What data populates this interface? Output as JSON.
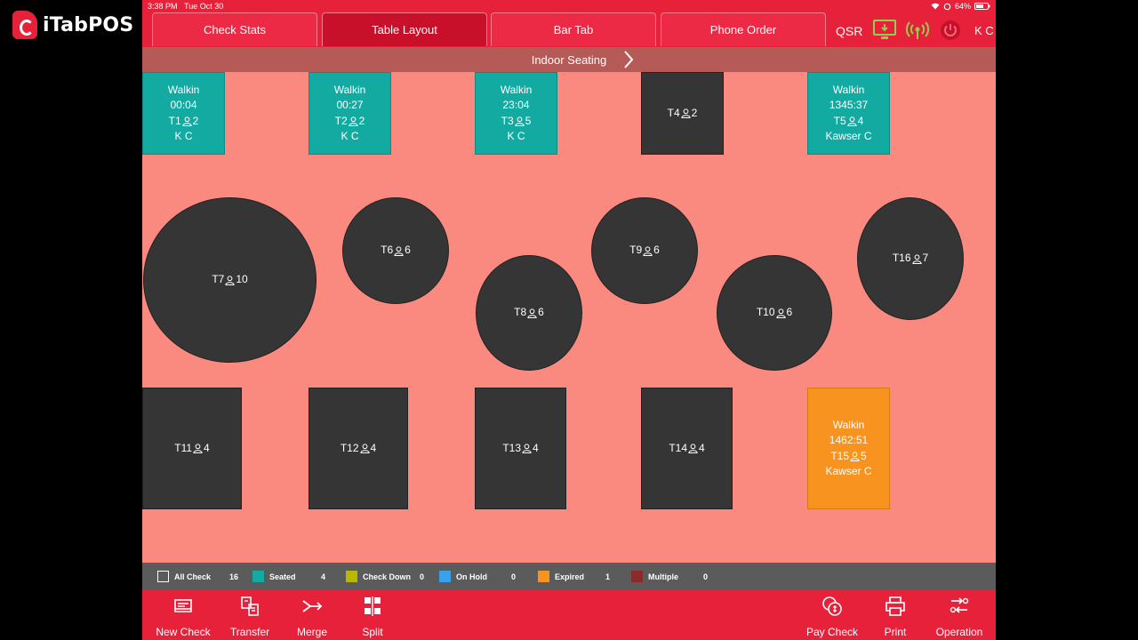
{
  "brand": {
    "name": "iTabPOS"
  },
  "status": {
    "time": "3:38 PM",
    "date": "Tue Oct 30",
    "battery": "64%"
  },
  "nav": {
    "tabs": [
      {
        "label": "Check Stats",
        "active": false
      },
      {
        "label": "Table Layout",
        "active": true
      },
      {
        "label": "Bar Tab",
        "active": false
      },
      {
        "label": "Phone Order",
        "active": false
      }
    ],
    "qsr_label": "QSR",
    "user_initials": "K C"
  },
  "section": {
    "title": "Indoor Seating"
  },
  "tables": [
    {
      "id": "T1",
      "seats": "2",
      "status": "seated",
      "customer": "Walkin",
      "time": "00:04",
      "server": "K C"
    },
    {
      "id": "T2",
      "seats": "2",
      "status": "seated",
      "customer": "Walkin",
      "time": "00:27",
      "server": "K C"
    },
    {
      "id": "T3",
      "seats": "5",
      "status": "seated",
      "customer": "Walkin",
      "time": "23:04",
      "server": "K C"
    },
    {
      "id": "T4",
      "seats": "2",
      "status": "open"
    },
    {
      "id": "T5",
      "seats": "4",
      "status": "seated",
      "customer": "Walkin",
      "time": "1345:37",
      "server": "Kawser C"
    },
    {
      "id": "T6",
      "seats": "6",
      "status": "open"
    },
    {
      "id": "T7",
      "seats": "10",
      "status": "open"
    },
    {
      "id": "T8",
      "seats": "6",
      "status": "open"
    },
    {
      "id": "T9",
      "seats": "6",
      "status": "open"
    },
    {
      "id": "T10",
      "seats": "6",
      "status": "open"
    },
    {
      "id": "T16",
      "seats": "7",
      "status": "open"
    },
    {
      "id": "T11",
      "seats": "4",
      "status": "open"
    },
    {
      "id": "T12",
      "seats": "4",
      "status": "open"
    },
    {
      "id": "T13",
      "seats": "4",
      "status": "open"
    },
    {
      "id": "T14",
      "seats": "4",
      "status": "open"
    },
    {
      "id": "T15",
      "seats": "5",
      "status": "expired",
      "customer": "Walkin",
      "time": "1462:51",
      "server": "Kawser C"
    }
  ],
  "legend": [
    {
      "label": "All Check",
      "count": "16",
      "color": "#ffffff",
      "outline": true
    },
    {
      "label": "Seated",
      "count": "4",
      "color": "#13aaa2"
    },
    {
      "label": "Check Down",
      "count": "0",
      "color": "#b8b800"
    },
    {
      "label": "On Hold",
      "count": "0",
      "color": "#3aa0e8"
    },
    {
      "label": "Expired",
      "count": "1",
      "color": "#f7931e"
    },
    {
      "label": "Multiple",
      "count": "0",
      "color": "#8b2a2a"
    }
  ],
  "actions": {
    "new_check": "New Check",
    "transfer": "Transfer",
    "merge": "Merge",
    "split": "Split",
    "pay_check": "Pay Check",
    "print": "Print",
    "operation": "Operation"
  },
  "colors": {
    "brand_red": "#e8213a",
    "floor": "#fa8a80",
    "open_table": "#353535",
    "seated": "#13aaa2",
    "expired": "#f7931e"
  }
}
